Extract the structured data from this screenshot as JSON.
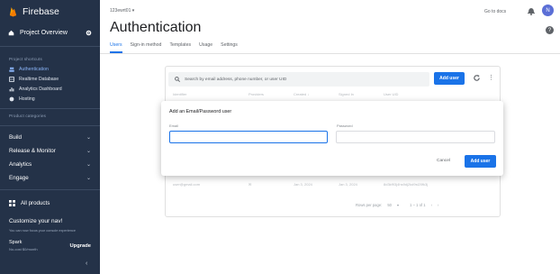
{
  "sidebar": {
    "brand": "Firebase",
    "project_overview": "Project Overview",
    "section_shortcuts": "Project shortcuts",
    "shortcuts": [
      "Authentication",
      "Realtime Database",
      "Analytics Dashboard",
      "Hosting"
    ],
    "section_categories": "Product categories",
    "groups": [
      "Build",
      "Release & Monitor",
      "Analytics",
      "Engage"
    ],
    "all_products": "All products",
    "promo_title": "Customize your nav!",
    "promo_text": "You can now focus your console experience",
    "plan_name": "Spark",
    "plan_desc": "No-cost $0/month",
    "upgrade": "Upgrade"
  },
  "topbar": {
    "project_selector": "123ewrt01 ▾",
    "goto_docs": "Go to docs",
    "avatar_letter": "N"
  },
  "page": {
    "title": "Authentication",
    "tabs": [
      "Users",
      "Sign-in method",
      "Templates",
      "Usage",
      "Settings"
    ],
    "active_tab": "Users"
  },
  "users_card": {
    "search_placeholder": "Search by email address, phone number, or user UID",
    "add_user": "Add user",
    "columns": [
      "Identifier",
      "Providers",
      "Created ↓",
      "Signed In",
      "User UID"
    ],
    "row": {
      "identifier": "user@gmail.com",
      "created": "Jan 3, 2024",
      "signed_in": "Jan 3, 2024",
      "uid": "8d3kf93j4hs9dj2kd9sl20fk3j"
    },
    "rows_per_page_label": "Rows per page:",
    "rows_per_page": "50",
    "range": "1 – 1 of 1"
  },
  "dialog": {
    "title": "Add an Email/Password user",
    "email_label": "Email",
    "password_label": "Password",
    "email_value": "",
    "password_value": "",
    "cancel": "Cancel",
    "add_user": "Add user"
  },
  "colors": {
    "sidebar_bg": "#243248",
    "primary": "#1a73e8",
    "brand_flame": "#ffa000"
  }
}
